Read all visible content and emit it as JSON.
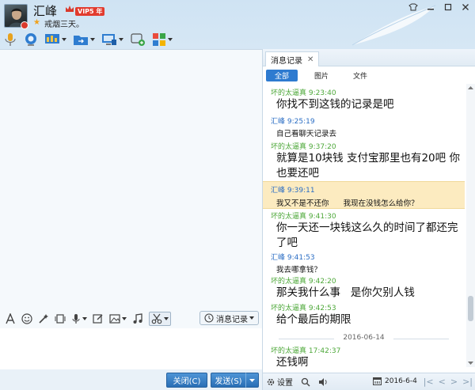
{
  "header": {
    "contact_name": "汇峰",
    "vip_label": "VIP5 年",
    "signature": "戒烟三天。"
  },
  "colors": {
    "accent_blue": "#2e7bd0",
    "my_name_color": "#2a6dc4",
    "other_name_color": "#4ea83a",
    "highlight": "#fcebc0"
  },
  "icons": {
    "toolbar": [
      "microphone-icon",
      "video-camera-icon",
      "screen-share-icon",
      "file-transfer-icon",
      "remote-desktop-icon",
      "app-add-icon",
      "apps-grid-icon"
    ],
    "input_toolbar": [
      "font-icon",
      "emoji-icon",
      "magic-wand-icon",
      "screenshot-frame-icon",
      "voice-message-icon",
      "edit-icon",
      "image-icon",
      "music-icon",
      "scissors-icon"
    ]
  },
  "input_toolbar": {
    "history_label": "消息记录"
  },
  "footer_left": {
    "close_label": "关闭(C)",
    "send_label": "发送(S)"
  },
  "history": {
    "tab_label": "消息记录",
    "filters": [
      "全部",
      "图片",
      "文件"
    ],
    "messages": [
      {
        "sender": "坏的太逼真",
        "time": "9:23:40",
        "text": "你找不到这钱的记录是吧",
        "mine": false,
        "big": true
      },
      {
        "sender": "汇峰",
        "time": "9:25:19",
        "text": "自己看聊天记录去",
        "mine": true,
        "big": false
      },
      {
        "sender": "坏的太逼真",
        "time": "9:37:20",
        "text": "就算是10块钱  支付宝那里也有20吧   你也要还吧",
        "mine": false,
        "big": true
      },
      {
        "sender": "汇峰",
        "time": "9:39:11",
        "text": "我又不是不还你      我现在没钱怎么给你？",
        "mine": true,
        "big": false,
        "highlight": true
      },
      {
        "sender": "坏的太逼真",
        "time": "9:41:30",
        "text": "你一天还一块钱这么久的时间了都还完了吧",
        "mine": false,
        "big": true
      },
      {
        "sender": "汇峰",
        "time": "9:41:53",
        "text": "我去哪拿钱？",
        "mine": true,
        "big": false
      },
      {
        "sender": "坏的太逼真",
        "time": "9:42:20",
        "text": "那关我什么事   是你欠别人钱",
        "mine": false,
        "big": true
      },
      {
        "sender": "坏的太逼真",
        "time": "9:42:53",
        "text": "给个最后的期限",
        "mine": false,
        "big": true
      },
      {
        "sender": "坏的太逼真",
        "time": "17:42:37",
        "text": "还钱啊",
        "mine": false,
        "big": true
      }
    ],
    "date_separator": "2016-06-14"
  },
  "footer_right": {
    "settings_label": "设置",
    "date": "2016-6-4"
  }
}
